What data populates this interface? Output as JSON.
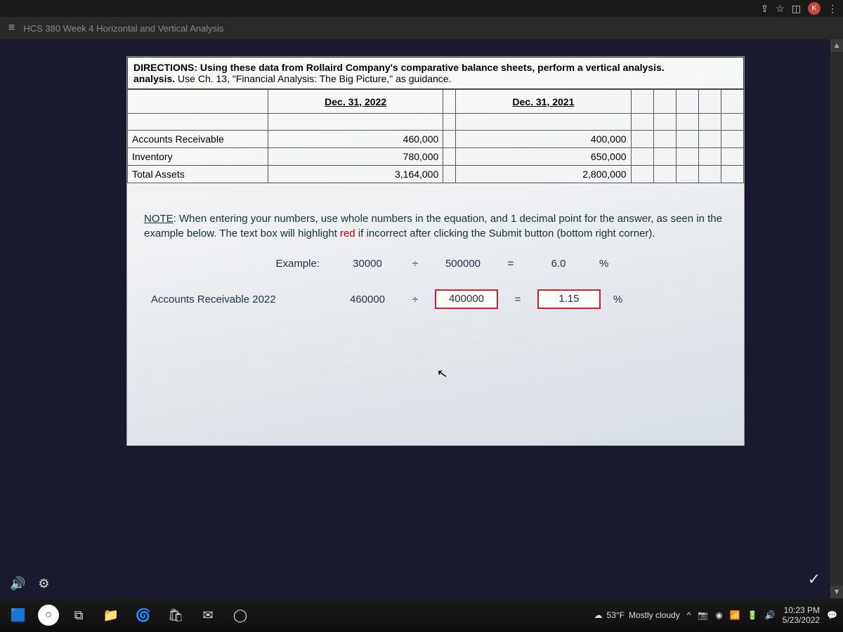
{
  "browser": {
    "avatar_letter": "K"
  },
  "title_bar": {
    "doc_title": "HCS 380 Week 4 Horizontal and Vertical Analysis"
  },
  "directions": {
    "label": "DIRECTIONS:",
    "line1": " Using these data from Rollaird Company's comparative balance sheets, perform a vertical analysis.",
    "line2": " Use Ch. 13, \"Financial Analysis: The Big Picture,\" as guidance."
  },
  "table": {
    "col1": "Dec. 31, 2022",
    "col2": "Dec. 31, 2021",
    "rows": [
      {
        "label": "Accounts Receivable",
        "v1": "460,000",
        "v2": "400,000"
      },
      {
        "label": "Inventory",
        "v1": "780,000",
        "v2": "650,000"
      },
      {
        "label": "Total Assets",
        "v1": "3,164,000",
        "v2": "2,800,000"
      }
    ]
  },
  "note": {
    "prefix": "NOTE",
    "body1": ": When entering your numbers, use whole numbers in the equation, and 1 decimal point for the answer, as seen in the example below. The text box will highlight ",
    "red": "red",
    "body2": " if incorrect after clicking the Submit button (bottom right corner)."
  },
  "example": {
    "label": "Example:",
    "a": "30000",
    "op1": "÷",
    "b": "500000",
    "eq": "=",
    "ans": "6.0",
    "pct": "%"
  },
  "ar_row": {
    "label": "Accounts Receivable 2022",
    "a": "460000",
    "op1": "÷",
    "b": "400000",
    "eq": "=",
    "ans": "1.15",
    "pct": "%"
  },
  "taskbar": {
    "weather_temp": "53°F",
    "weather_text": "Mostly cloudy",
    "time": "10:23 PM",
    "date": "5/23/2022"
  }
}
